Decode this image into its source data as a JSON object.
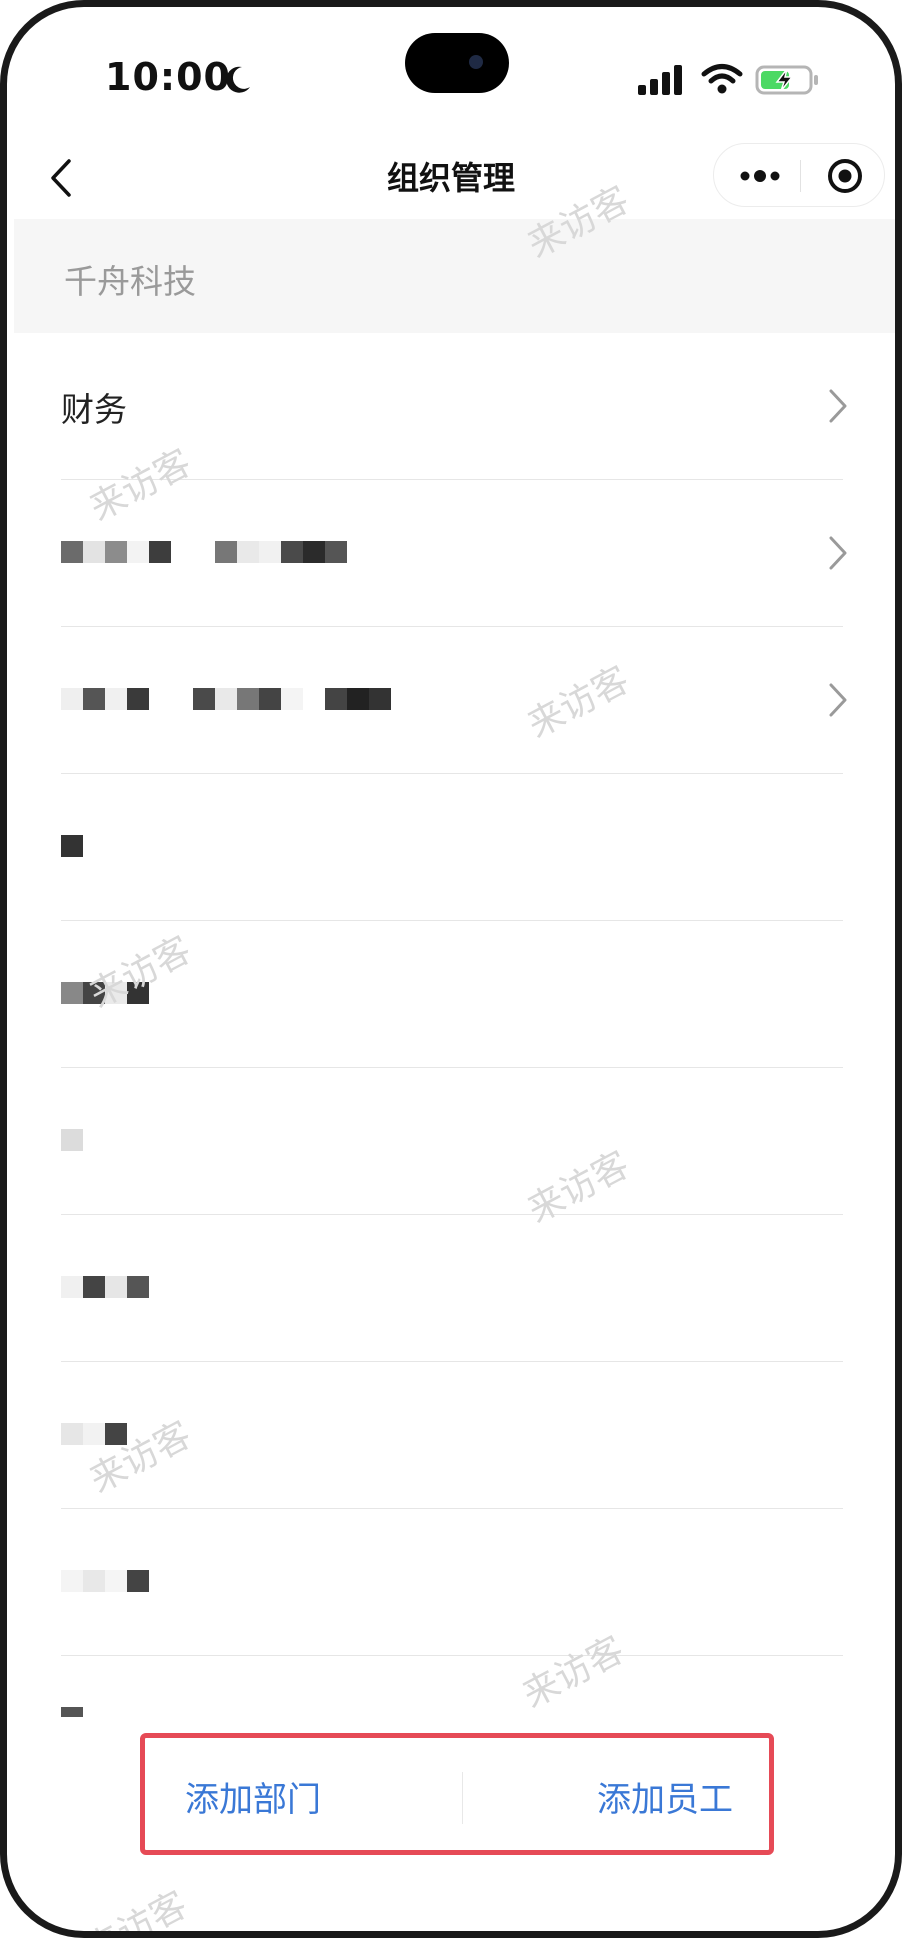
{
  "status": {
    "time": "10:00",
    "moon_icon": "moon-icon",
    "signal_icon": "signal-icon",
    "wifi_icon": "wifi-icon",
    "battery_icon": "battery-charging-icon",
    "battery_color": "#4cd964"
  },
  "nav": {
    "title": "组织管理",
    "back_icon": "chevron-left-icon",
    "more_icon": "more-dots-icon",
    "target_icon": "target-icon"
  },
  "company": {
    "name": "千舟科技"
  },
  "departments": [
    {
      "label": "财务",
      "has_children": true
    },
    {
      "label": "",
      "has_children": true
    },
    {
      "label": "",
      "has_children": true
    },
    {
      "label": "",
      "has_children": false
    },
    {
      "label": "",
      "has_children": false
    },
    {
      "label": "",
      "has_children": false
    },
    {
      "label": "",
      "has_children": false
    },
    {
      "label": "",
      "has_children": false
    },
    {
      "label": "",
      "has_children": false
    }
  ],
  "watermark": "来访客",
  "actions": {
    "add_department": "添加部门",
    "add_employee": "添加员工",
    "accent_color": "#3a78d6",
    "highlight_color": "#e64a56"
  }
}
